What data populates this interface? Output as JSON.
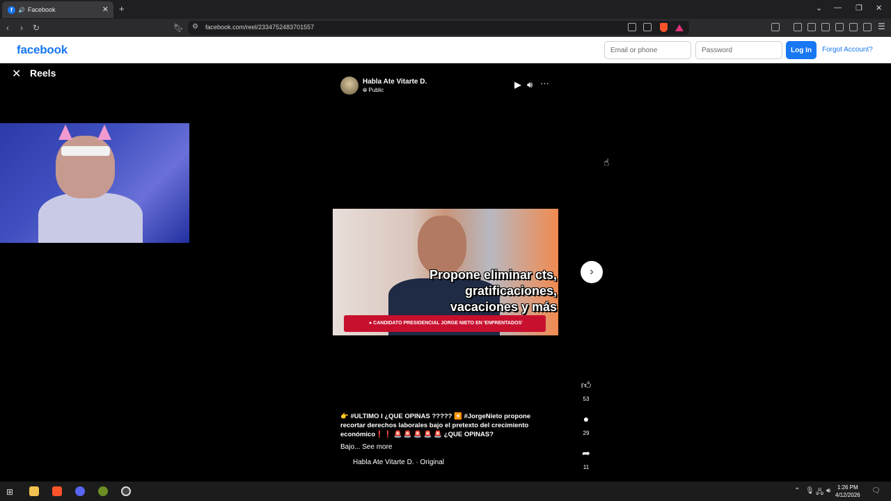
{
  "browser": {
    "tab_title": "Facebook",
    "tab_close": "✕",
    "new_tab": "+",
    "url": "facebook.com/reel/2334752483701557",
    "window_controls": [
      "⌄",
      "—",
      "❐",
      "✕"
    ]
  },
  "header": {
    "logo": "facebook",
    "email_placeholder": "Email or phone",
    "password_placeholder": "Password",
    "login_label": "Log In",
    "forgot_label": "Forgot Account?"
  },
  "reels": {
    "title": "Reels",
    "close_icon": "✕",
    "author": "Habla Ate Vitarte D.",
    "visibility": "Public",
    "video_caption": [
      "Propone eliminar cts,",
      "gratificaciones,",
      "vacaciones y más"
    ],
    "video_banner": "● CANDIDATO PRESIDENCIAL JORGE NIETO EN 'ENFRENTADOS'",
    "like_count": "53",
    "comment_count": "29",
    "share_count": "11",
    "description": "👉 #ULTIMO I ¿QUE OPINAS ????? ◀️ #JorgeNieto propone recortar derechos laborales bajo el pretexto del crecimiento económico❗❗ 🚨 🚨 🚨 🚨 🚨 ¿QUE OPINAS?",
    "desc_short": "Bajo...",
    "see_more": "See more",
    "audio": "Habla Ate Vitarte D. · Original"
  },
  "taskbar": {
    "time": "1:26 PM",
    "date": "4/12/2026"
  },
  "colors": {
    "fb_blue": "#1877f2",
    "chrome_dark": "#2b2b2e",
    "banner_red": "#c8102e"
  }
}
